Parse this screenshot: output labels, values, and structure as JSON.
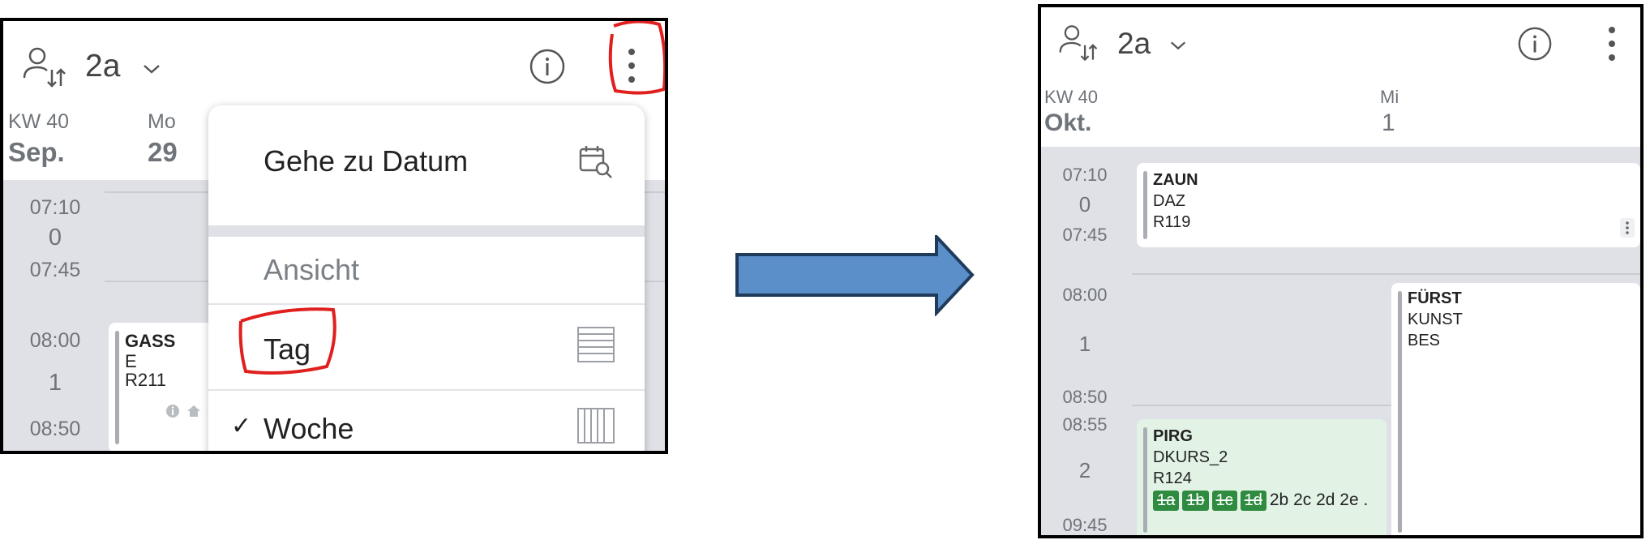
{
  "left_panel": {
    "header": {
      "class_label": "2a",
      "chevron": "chevron-down-icon",
      "info_icon": "info-icon",
      "more_icon": "more-vert-icon"
    },
    "week": {
      "kw": "KW 40",
      "month": "Sep."
    },
    "day": {
      "name": "Mo",
      "number": "29"
    },
    "periods": [
      {
        "start": "07:10",
        "number": "0",
        "end": "07:45"
      },
      {
        "start": "08:00",
        "number": "1",
        "end": "08:50"
      }
    ],
    "lesson": {
      "teacher": "GASS",
      "subject": "E",
      "room": "R211"
    },
    "menu": {
      "goto_date": "Gehe zu Datum",
      "section_view": "Ansicht",
      "view_day": "Tag",
      "view_week": "Woche",
      "checkmark": "✓"
    }
  },
  "right_panel": {
    "header": {
      "class_label": "2a",
      "chevron": "chevron-down-icon",
      "info_icon": "info-icon",
      "more_icon": "more-vert-icon"
    },
    "week": {
      "kw": "KW 40",
      "month": "Okt."
    },
    "day": {
      "name": "Mi",
      "number": "1"
    },
    "periods": [
      {
        "start": "07:10",
        "number": "0",
        "end": "07:45"
      },
      {
        "start": "08:00",
        "number": "1",
        "end": "08:50"
      },
      {
        "start": "08:55",
        "number": "2",
        "end": "09:45"
      }
    ],
    "lessons": [
      {
        "teacher": "ZAUN",
        "subject": "DAZ",
        "room": "R119"
      },
      {
        "teacher": "FÜRST",
        "subject": "KUNST",
        "room": "BES"
      },
      {
        "teacher": "PIRG",
        "subject": "DKURS_2",
        "room": "R124",
        "classes_struck": [
          "1a",
          "1b",
          "1c",
          "1d"
        ],
        "classes_rest": "2b 2c 2d 2e ."
      }
    ]
  },
  "colors": {
    "annotation_red": "#e0201e",
    "arrow_fill": "#5b8fc9",
    "arrow_stroke": "#1f3b5c",
    "grid_gray": "#dfe1e6",
    "highlight_green": "#e2f3e6",
    "chip_green": "#2e8b3f"
  }
}
